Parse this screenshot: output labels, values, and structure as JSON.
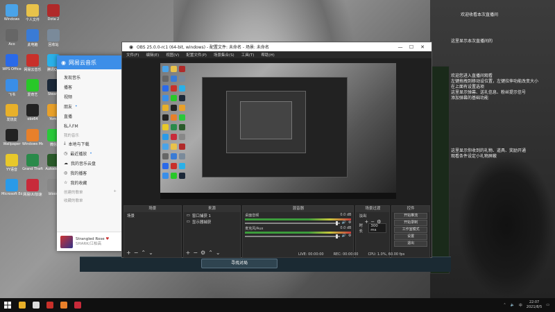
{
  "desktop": {
    "icons": [
      {
        "label": "Windows",
        "color": "#4aa3e8"
      },
      {
        "label": "个人文件",
        "color": "#e8c24a"
      },
      {
        "label": "Dota 2",
        "color": "#b02a2a"
      },
      {
        "label": "Aco",
        "color": "#666666"
      },
      {
        "label": "此电脑",
        "color": "#3a7bd5"
      },
      {
        "label": "回收站",
        "color": "#7a8a9a"
      },
      {
        "label": "WPS Office",
        "color": "#2a6ae8"
      },
      {
        "label": "网易云音乐",
        "color": "#c8302a"
      },
      {
        "label": "腾讯QQ",
        "color": "#2ab0e8"
      },
      {
        "label": "飞书",
        "color": "#3a8ee8"
      },
      {
        "label": "爱奇艺",
        "color": "#28c828"
      },
      {
        "label": "Steam",
        "color": "#1b2838"
      },
      {
        "label": "发烧友",
        "color": "#e8b02a"
      },
      {
        "label": "obs64",
        "color": "#222222"
      },
      {
        "label": "Yomi",
        "color": "#e8a02a"
      },
      {
        "label": "Wallpaper",
        "color": "#222222"
      },
      {
        "label": "Windows Media",
        "color": "#e8802a"
      },
      {
        "label": "微信",
        "color": "#2ac83a"
      },
      {
        "label": "YY语音",
        "color": "#e8c82a"
      },
      {
        "label": "Grand Theft",
        "color": "#2a8a4a"
      },
      {
        "label": "Autodesk",
        "color": "#2a5a2a"
      },
      {
        "label": "Microsoft Edge",
        "color": "#2a9ae8"
      },
      {
        "label": "网易UU加速",
        "color": "#c82a3a"
      },
      {
        "label": "blood",
        "color": "#888888"
      }
    ]
  },
  "overlay": {
    "lines": [
      "欢迎收看本次直播间",
      "这里显示本次直播间的",
      "欢迎您进入直播间观看",
      "左键拖拽到移动设位置，左键拉伸功能改变大小",
      "在上面有设置选项",
      "这里显示弹幕、送礼信息、粉丝提示信号",
      "添加弹幕的基础功能",
      "这里显示你收到的礼物、道具、奖励开通",
      "观看条件设定小礼物屏蔽"
    ]
  },
  "music": {
    "title": "网易云音乐",
    "items": [
      "发现音乐",
      "播客",
      "视频",
      "朋友",
      "直播",
      "私人FM"
    ],
    "section1": "我的音乐",
    "my_items": [
      "本地与下载",
      "最近播放",
      "我的音乐云盘",
      "我的播客",
      "我的收藏"
    ],
    "section2": "创建的歌单",
    "section3": "收藏的歌单",
    "now_playing": {
      "song": "Strangled Rose",
      "artist": "SHARK/江柏高"
    }
  },
  "obs": {
    "title": "OBS 25.0.0-rc1 (64-bit, windows) - 配置文件: 未命名 - 场景: 未命名",
    "menu": [
      "文件(F)",
      "编辑(E)",
      "视图(V)",
      "配置文件(P)",
      "场景集合(S)",
      "工具(T)",
      "帮助(H)"
    ],
    "docks": {
      "scenes": {
        "header": "场景",
        "items": [
          "场景"
        ]
      },
      "sources": {
        "header": "来源",
        "items": [
          "窗口捕获 1",
          "显示器捕获"
        ]
      },
      "mixer": {
        "header": "混音器",
        "channels": [
          {
            "name": "桌面音频",
            "db": "0.0 dB"
          },
          {
            "name": "麦克风/Aux",
            "db": "0.0 dB"
          }
        ]
      },
      "transitions": {
        "header": "场景过渡",
        "type": "淡出",
        "duration_label": "时长",
        "duration": "300 ms"
      },
      "controls": {
        "header": "控件",
        "buttons": [
          "开始推流",
          "开始录制",
          "工作室模式",
          "设置",
          "退出"
        ]
      }
    },
    "status": {
      "live": "LIVE: 00:00:00",
      "rec": "REC: 00:00:00",
      "cpu": "CPU: 1.0%, 60.00 fps"
    }
  },
  "behind": {
    "find_button": "寻找对局"
  },
  "taskbar": {
    "time": "22:07",
    "date": "2021/8/5",
    "ime": "中",
    "apps": [
      "#e8b02a",
      "#dddddd",
      "#c8302a",
      "#e8802a",
      "#c82a3a"
    ]
  },
  "colors": {
    "obs_bg": "#1f1f1f",
    "music_accent": "#3c8ee8"
  }
}
